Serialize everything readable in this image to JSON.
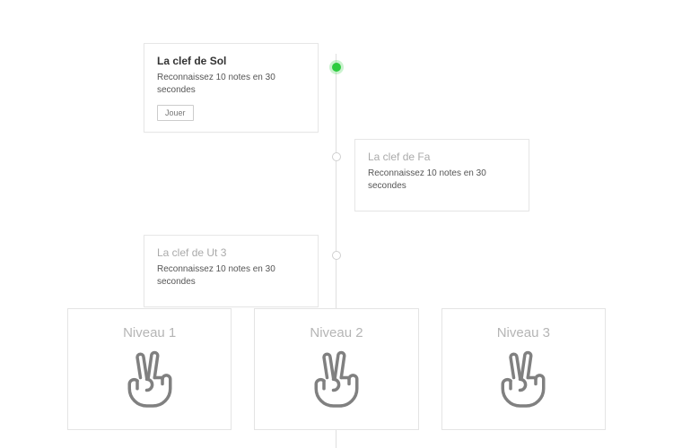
{
  "timeline": {
    "items": [
      {
        "title": "La clef de Sol",
        "desc": "Reconnaissez 10 notes en 30 secondes",
        "button": "Jouer",
        "active": true
      },
      {
        "title": "La clef de Fa",
        "desc": "Reconnaissez 10 notes en 30 secondes",
        "active": false
      },
      {
        "title": "La clef de Ut 3",
        "desc": "Reconnaissez 10 notes en 30 secondes",
        "active": false
      }
    ]
  },
  "levels": [
    {
      "label": "Niveau 1"
    },
    {
      "label": "Niveau 2"
    },
    {
      "label": "Niveau 3"
    }
  ]
}
